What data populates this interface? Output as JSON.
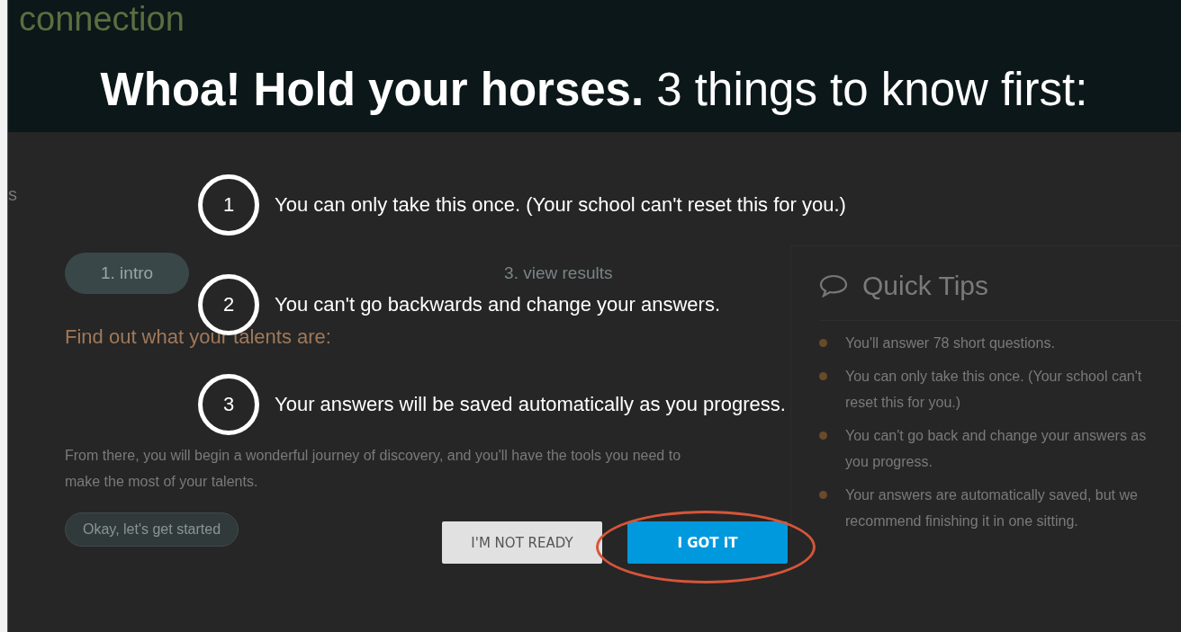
{
  "header": {
    "site_name": "connection"
  },
  "sidebar": {
    "fragment": "s"
  },
  "steps": [
    {
      "label": "1. intro",
      "selected": true
    },
    {
      "label": "3. view results",
      "selected": false
    }
  ],
  "content": {
    "heading": "Find out what your talents are:",
    "paragraph": "From there, you will begin a wonderful journey of discovery, and you'll have the tools you need to make the most of your talents.",
    "start_button": "Okay, let's get started"
  },
  "quick_tips": {
    "title": "Quick Tips",
    "items": [
      "You'll answer 78 short questions.",
      "You can only take this once. (Your school can't reset this for you.)",
      "You can't go back and change your answers as you progress.",
      "Your answers are automatically saved, but we recommend finishing it in one sitting."
    ]
  },
  "modal": {
    "title": "**Whoa! Hold your horses.** 3 things to know first:",
    "items": [
      {
        "number": "1",
        "text": "You can only take this once. (Your school can't reset this for you.)"
      },
      {
        "number": "2",
        "text": "You can't go backwards and change your answers."
      },
      {
        "number": "3",
        "text": "Your answers will be saved automatically as you progress."
      }
    ],
    "buttons": [
      {
        "label": "I'M NOT READY",
        "kind": "secondary",
        "highlighted": false
      },
      {
        "label": "I GOT IT",
        "kind": "primary",
        "highlighted": true
      }
    ]
  }
}
